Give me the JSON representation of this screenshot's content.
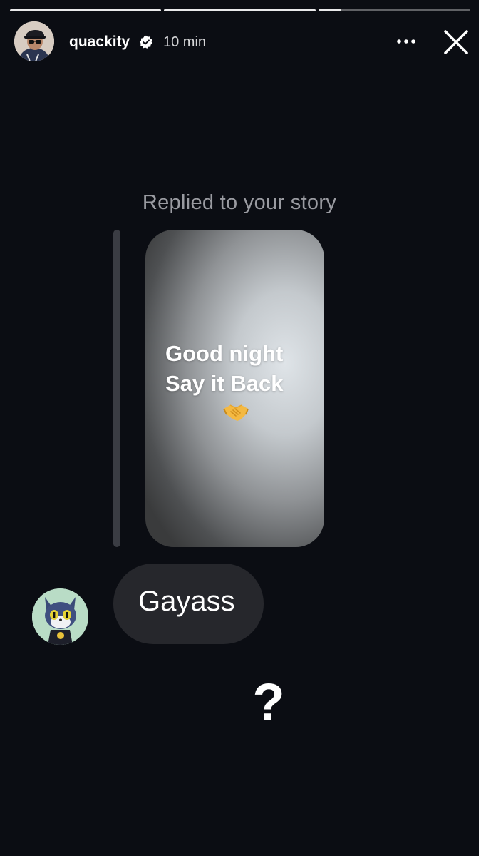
{
  "story": {
    "progress": [
      {
        "fraction": 1.0
      },
      {
        "fraction": 1.0
      },
      {
        "fraction": 0.15
      }
    ]
  },
  "header": {
    "username": "quackity",
    "verified": true,
    "time": "10 min",
    "more_icon": "more-horizontal-icon",
    "close_icon": "close-icon"
  },
  "reply": {
    "caption": "Replied to your story",
    "story_card": {
      "line1": "Good night",
      "line2": "Say it Back",
      "emoji": "handshake-emoji"
    }
  },
  "message": {
    "text": "Gayass"
  },
  "overlay": {
    "text": "?"
  },
  "colors": {
    "background": "#0b0d13",
    "bubble": "#26272c",
    "caption": "#9a9ba1",
    "quote_bar": "#3a3c43"
  }
}
